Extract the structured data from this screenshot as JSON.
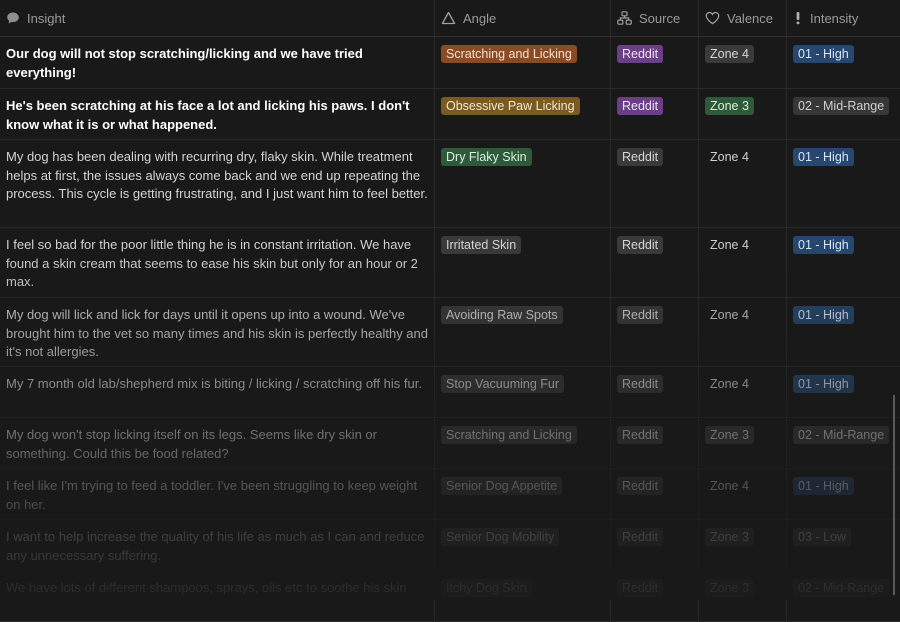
{
  "headers": {
    "insight": "Insight",
    "angle": "Angle",
    "source": "Source",
    "valence": "Valence",
    "intensity": "Intensity"
  },
  "rows": [
    {
      "insight": "Our dog will not stop scratching/licking and we have tried everything!",
      "angle": "Scratching and Licking",
      "source": "Reddit",
      "valence": "Zone 4",
      "intensity": "01 - High"
    },
    {
      "insight": "He's been scratching at his face a lot and licking his paws. I don't know what it is or what happened.",
      "angle": "Obsessive Paw Licking",
      "source": "Reddit",
      "valence": "Zone 3",
      "intensity": "02 - Mid-Range"
    },
    {
      "insight": "My dog has been dealing with recurring dry, flaky skin. While treatment helps at first, the issues always come back and we end up repeating the process. This cycle is getting frustrating, and I just want him to feel better.",
      "angle": "Dry Flaky Skin",
      "source": "Reddit",
      "valence": "Zone 4",
      "intensity": "01 - High"
    },
    {
      "insight": "I feel so bad for the poor little thing he is in constant irritation. We have found a skin cream that seems to ease his skin but only for an hour or 2 max.",
      "angle": "Irritated Skin",
      "source": "Reddit",
      "valence": "Zone 4",
      "intensity": "01 - High"
    },
    {
      "insight": "My dog will lick and lick for days until it opens up into a wound. We've brought him to the vet so many times and his skin is perfectly healthy and it's not allergies.",
      "angle": "Avoiding Raw Spots",
      "source": "Reddit",
      "valence": "Zone 4",
      "intensity": "01 - High"
    },
    {
      "insight": "My 7 month old lab/shepherd mix is biting / licking / scratching off his fur.",
      "angle": "Stop Vacuuming Fur",
      "source": "Reddit",
      "valence": "Zone 4",
      "intensity": "01 - High"
    },
    {
      "insight": "My dog won't stop licking itself on its legs. Seems like dry skin or something. Could this be food related?",
      "angle": "Scratching and Licking",
      "source": "Reddit",
      "valence": "Zone 3",
      "intensity": "02 - Mid-Range"
    },
    {
      "insight": "I feel like I'm trying to feed a toddler. I've been struggling to keep weight on her.",
      "angle": "Senior Dog Appetite",
      "source": "Reddit",
      "valence": "Zone 4",
      "intensity": "01 - High"
    },
    {
      "insight": "I want to help increase the quality of his life as much as I can and reduce any unnecessary suffering.",
      "angle": "Senior Dog Mobility",
      "source": "Reddit",
      "valence": "Zone 3",
      "intensity": "03 - Low"
    },
    {
      "insight": "We have lots of different shampoos, sprays, oils etc to soothe his skin",
      "angle": "Itchy Dog Skin",
      "source": "Reddit",
      "valence": "Zone 3",
      "intensity": "02 - Mid-Range"
    }
  ],
  "colors": {
    "background": "#191919",
    "orange": "#8a4a23",
    "brown": "#7a5a23",
    "green": "#2f5a3a",
    "purple": "#6b3f86",
    "blue": "#27476f",
    "gray": "#373737"
  },
  "icons": {
    "insight": "speech-bubble-icon",
    "angle": "triangle-icon",
    "source": "org-chart-icon",
    "valence": "heart-icon",
    "intensity": "exclamation-icon"
  }
}
